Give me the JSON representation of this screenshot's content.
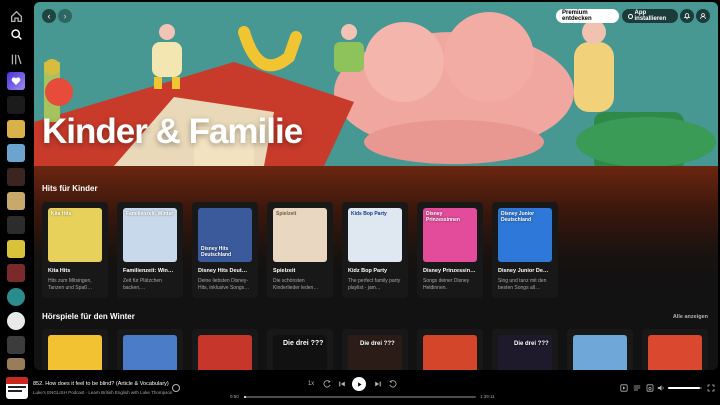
{
  "rail": {
    "icons": [
      "home-icon",
      "search-icon",
      "library-icon"
    ]
  },
  "hero": {
    "title": "Kinder & Familie",
    "premium_label": "Premium entdecken",
    "install_label": "App installieren"
  },
  "sections": [
    {
      "title": "Hits für Kinder",
      "cards": [
        {
          "cover_text": "Kita Hits",
          "title": "Kita Hits",
          "desc": "Hits zum Mitsingen, Tanzen und Spaß…",
          "color": "#e8d15a"
        },
        {
          "cover_text": "Familienzeit: Winter",
          "title": "Familienzeit: Win…",
          "desc": "Zeit für Plätzchen backen,…",
          "color": "#c9d9ec"
        },
        {
          "cover_text": "Disney Hits Deutschland",
          "title": "Disney Hits Deut…",
          "desc": "Deine liebsten Disney-Hits, inklusive Songs…",
          "color": "#3a5a9c"
        },
        {
          "cover_text": "Spielzeit",
          "title": "Spielzeit",
          "desc": "Die schönsten Kinderlieder leden…",
          "color": "#e9d7c1"
        },
        {
          "cover_text": "Kids Bop Party",
          "title": "Kidz Bop Party",
          "desc": "The perfect family party playlist - jam…",
          "color": "#dfe7f1"
        },
        {
          "cover_text": "Disney Prinzessinnen",
          "title": "Disney Prinzessin…",
          "desc": "Songs deiner Disney Heldinnen.",
          "color": "#e24c9b"
        },
        {
          "cover_text": "Disney Junior Deutschland",
          "title": "Disney Junior De…",
          "desc": "Sing und tanz mit den besten Songs all…",
          "color": "#2d78d8"
        }
      ]
    },
    {
      "title": "Hörspiele für den Winter",
      "show_all": "Alle anzeigen",
      "cards": [
        {
          "color": "#f2c233"
        },
        {
          "color": "#4a7cc8"
        },
        {
          "color": "#c7362a"
        },
        {
          "cover_text": "Die drei ???",
          "color": "#111111"
        },
        {
          "cover_text": "Die drei ???",
          "color": "#2b1c18"
        },
        {
          "color": "#d3462a"
        },
        {
          "cover_text": "Die drei ???",
          "color": "#1e1a2c"
        },
        {
          "color": "#6fa8d8"
        },
        {
          "color": "#d9482f"
        }
      ]
    }
  ],
  "player": {
    "title": "852. How does it feel to be blind? (Article & Vocabulary)",
    "subtitle": "Luke's ENGLISH Podcast - Learn British English with Luke Thompson",
    "speed": "1x",
    "elapsed": "0:50",
    "duration": "1:39:11",
    "progress": 0.01,
    "volume": 0.95
  }
}
